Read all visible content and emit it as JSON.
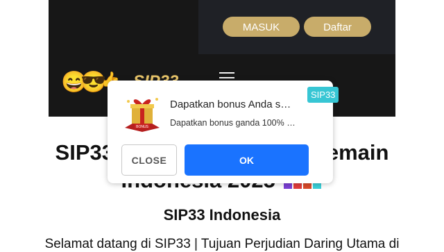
{
  "header": {
    "login_label": "MASUK",
    "register_label": "Daftar",
    "logo_text": "SIP33"
  },
  "page": {
    "headline_left": "SIP33 -",
    "headline_right": "Pemain",
    "headline_line2": "Indonesia 2025",
    "subheading": "SIP33 Indonesia",
    "intro": "Selamat datang di SIP33 | Tujuan Perjudian Daring Utama di"
  },
  "notification": {
    "title": "Dapatkan bonus Anda s…",
    "body": "Dapatkan bonus ganda 100% …",
    "badge": "SIP33",
    "gift_label": "BONUS",
    "close_label": "CLOSE",
    "ok_label": "OK"
  },
  "colors": {
    "accent_gold": "#c8ac6a",
    "ok_blue": "#1a73ff",
    "badge_cyan": "#37c6d4"
  }
}
